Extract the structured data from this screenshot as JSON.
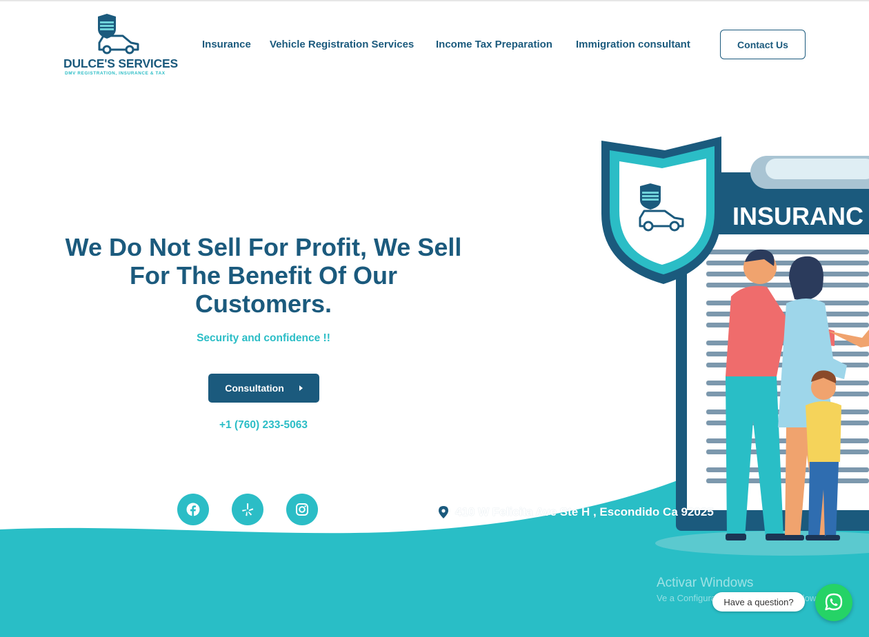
{
  "brand": {
    "name": "DULCE'S SERVICES",
    "tagline": "DMV REGISTRATION, INSURANCE & TAX"
  },
  "nav": {
    "items": [
      {
        "label": "Insurance"
      },
      {
        "label": "Vehicle Registration Services"
      },
      {
        "label": "Income Tax Preparation"
      },
      {
        "label": "Immigration consultant"
      }
    ],
    "contact_label": "Contact Us"
  },
  "hero": {
    "headline": "We Do Not Sell For Profit, We Sell For The Benefit Of Our Customers.",
    "tagline": "Security and confidence !!",
    "button_label": "Consultation",
    "phone": "+1 (760) 233-5063"
  },
  "social": [
    {
      "icon": "facebook-icon"
    },
    {
      "icon": "yelp-icon"
    },
    {
      "icon": "instagram-icon"
    }
  ],
  "address": {
    "icon": "map-pin-icon",
    "text": "410 W Felicita Ave Ste H , Escondido Ca 92025"
  },
  "illustration": {
    "sign_text": "INSURANC"
  },
  "watermark": {
    "title": "Activar Windows",
    "subtitle": "Ve a Configuración para activar Windows."
  },
  "whatsapp": {
    "bubble": "Have a question?",
    "icon": "whatsapp-icon"
  },
  "colors": {
    "primary": "#1b5a7d",
    "accent": "#2bbdc6",
    "whatsapp": "#25d366"
  }
}
